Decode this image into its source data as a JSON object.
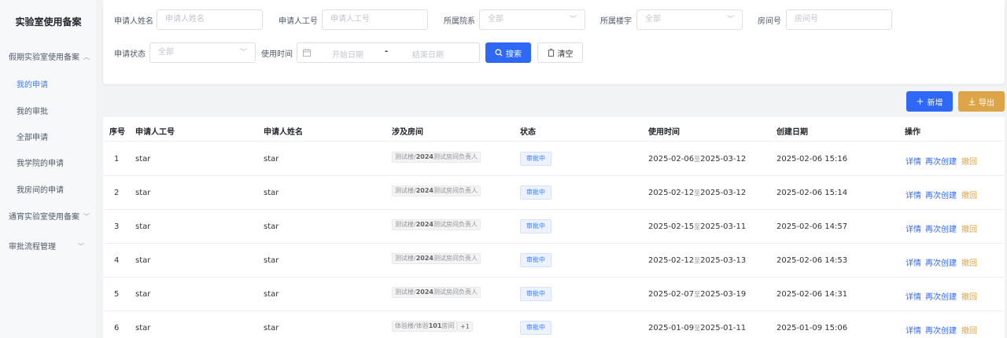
{
  "sidebar": {
    "title": "实验室使用备案",
    "groups": [
      {
        "label": "假期实验室使用备案",
        "expanded": true
      },
      {
        "label": "通宵实验室使用备案",
        "expanded": false
      },
      {
        "label": "审批流程管理",
        "expanded": false
      }
    ],
    "items": [
      {
        "label": "我的申请",
        "active": true
      },
      {
        "label": "我的审批",
        "active": false
      },
      {
        "label": "全部申请",
        "active": false
      },
      {
        "label": "我学院的申请",
        "active": false
      },
      {
        "label": "我房间的申请",
        "active": false
      }
    ]
  },
  "filters": {
    "applicant_name": {
      "label": "申请人姓名",
      "placeholder": "申请人姓名"
    },
    "applicant_id": {
      "label": "申请人工号",
      "placeholder": "申请人工号"
    },
    "college": {
      "label": "所属院系",
      "value": "全部"
    },
    "building": {
      "label": "所属楼宇",
      "value": "全部"
    },
    "room": {
      "label": "房间号",
      "placeholder": "房间号"
    },
    "status": {
      "label": "申请状态",
      "value": "全部"
    },
    "time": {
      "label": "使用时间",
      "start_placeholder": "开始日期",
      "separator": "-",
      "end_placeholder": "结束日期"
    },
    "search_label": "搜索",
    "clear_label": "清空"
  },
  "actions": {
    "add_label": "新增",
    "export_label": "导出"
  },
  "table": {
    "headers": [
      "序号",
      "申请人工号",
      "申请人姓名",
      "涉及房间",
      "状态",
      "使用时间",
      "创建日期",
      "操作"
    ],
    "rows": [
      {
        "no": "1",
        "emp_id": "star",
        "name": "star",
        "room_prefix": "测试楼/",
        "room_bold": "2024",
        "room_suffix": "测试房间负责人",
        "extra": "",
        "status": "审批中",
        "start": "2025-02-06",
        "to": "至",
        "end": "2025-03-12",
        "created": "2025-02-06 15:16"
      },
      {
        "no": "2",
        "emp_id": "star",
        "name": "star",
        "room_prefix": "测试楼/",
        "room_bold": "2024",
        "room_suffix": "测试房间负责人",
        "extra": "",
        "status": "审批中",
        "start": "2025-02-12",
        "to": "至",
        "end": "2025-03-12",
        "created": "2025-02-06 15:14"
      },
      {
        "no": "3",
        "emp_id": "star",
        "name": "star",
        "room_prefix": "测试楼/",
        "room_bold": "2024",
        "room_suffix": "测试房间负责人",
        "extra": "",
        "status": "审批中",
        "start": "2025-02-15",
        "to": "至",
        "end": "2025-03-11",
        "created": "2025-02-06 14:57"
      },
      {
        "no": "4",
        "emp_id": "star",
        "name": "star",
        "room_prefix": "测试楼/",
        "room_bold": "2024",
        "room_suffix": "测试房间负责人",
        "extra": "",
        "status": "审批中",
        "start": "2025-02-12",
        "to": "至",
        "end": "2025-03-13",
        "created": "2025-02-06 14:53"
      },
      {
        "no": "5",
        "emp_id": "star",
        "name": "star",
        "room_prefix": "测试楼/",
        "room_bold": "2024",
        "room_suffix": "测试房间负责人",
        "extra": "",
        "status": "审批中",
        "start": "2025-02-07",
        "to": "至",
        "end": "2025-03-19",
        "created": "2025-02-06 14:31"
      },
      {
        "no": "6",
        "emp_id": "star",
        "name": "star",
        "room_prefix": "体验楼/体验",
        "room_bold": "101",
        "room_suffix": "房间",
        "extra": "+1",
        "status": "审批中",
        "start": "2025-01-09",
        "to": "至",
        "end": "2025-01-11",
        "created": "2025-01-09 15:06"
      }
    ],
    "row_actions": {
      "detail": "详情",
      "recreate": "再次创建",
      "withdraw": "撤回"
    }
  }
}
